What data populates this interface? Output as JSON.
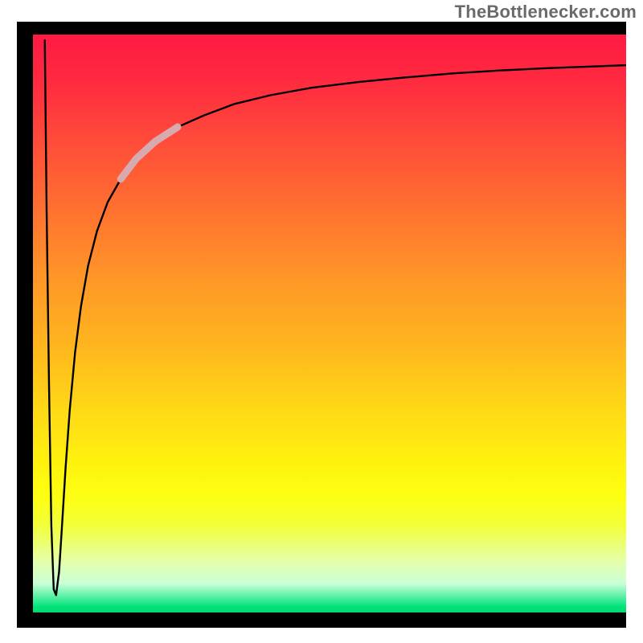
{
  "attribution": "TheBottlenecker.com",
  "chart_data": {
    "type": "line",
    "title": "",
    "xlabel": "",
    "ylabel": "",
    "xlim": [
      0,
      100
    ],
    "ylim": [
      0,
      100
    ],
    "curve": {
      "x": [
        2.0,
        2.3,
        2.7,
        3.1,
        3.5,
        3.9,
        4.4,
        4.9,
        5.5,
        6.2,
        7.1,
        8.1,
        9.3,
        10.8,
        12.6,
        14.8,
        17.4,
        20.6,
        24.4,
        28.8,
        34.0,
        40.0,
        47.0,
        55.0,
        63.0,
        71.0,
        79.0,
        87.0,
        95.0,
        100.0
      ],
      "y": [
        99.0,
        70.0,
        40.0,
        15.0,
        4.0,
        3.0,
        7.0,
        15.0,
        25.0,
        35.0,
        45.0,
        53.0,
        60.0,
        66.0,
        71.0,
        75.0,
        78.5,
        81.5,
        84.0,
        86.0,
        88.0,
        89.5,
        90.8,
        91.8,
        92.6,
        93.3,
        93.8,
        94.2,
        94.5,
        94.7
      ]
    },
    "highlight_segment": {
      "x": [
        14.8,
        17.4,
        20.6,
        24.4
      ],
      "y": [
        75.0,
        78.5,
        81.5,
        84.0
      ]
    },
    "gradient_stops": [
      {
        "pos": 0.0,
        "color": "#ff1a44"
      },
      {
        "pos": 0.3,
        "color": "#ff7030"
      },
      {
        "pos": 0.65,
        "color": "#ffd916"
      },
      {
        "pos": 0.8,
        "color": "#fdff12"
      },
      {
        "pos": 0.95,
        "color": "#c9ffd8"
      },
      {
        "pos": 1.0,
        "color": "#00d873"
      }
    ]
  }
}
